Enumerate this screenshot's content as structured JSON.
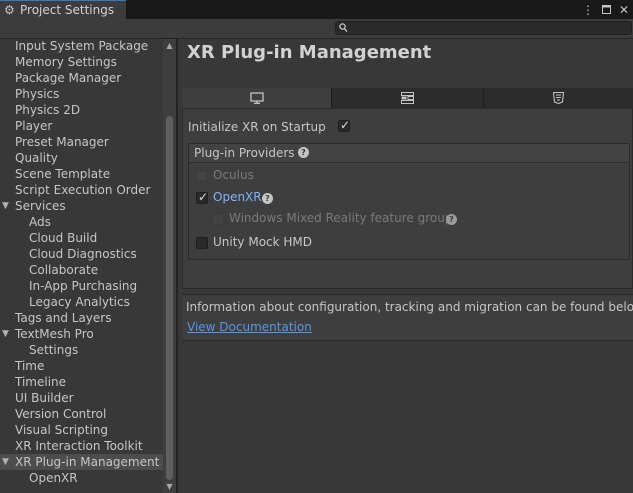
{
  "window": {
    "tab_title": "Project Settings",
    "icons": [
      "gear-icon",
      "kebab-menu-icon",
      "maximize-icon",
      "close-icon"
    ]
  },
  "search": {
    "placeholder": "",
    "icon": "search-icon"
  },
  "sidebar": {
    "items": [
      {
        "label": "Input System Package",
        "indent": 0
      },
      {
        "label": "Memory Settings",
        "indent": 0
      },
      {
        "label": "Package Manager",
        "indent": 0
      },
      {
        "label": "Physics",
        "indent": 0
      },
      {
        "label": "Physics 2D",
        "indent": 0
      },
      {
        "label": "Player",
        "indent": 0
      },
      {
        "label": "Preset Manager",
        "indent": 0
      },
      {
        "label": "Quality",
        "indent": 0
      },
      {
        "label": "Scene Template",
        "indent": 0
      },
      {
        "label": "Script Execution Order",
        "indent": 0
      },
      {
        "label": "Services",
        "indent": 0,
        "foldout": "expanded"
      },
      {
        "label": "Ads",
        "indent": 1
      },
      {
        "label": "Cloud Build",
        "indent": 1
      },
      {
        "label": "Cloud Diagnostics",
        "indent": 1
      },
      {
        "label": "Collaborate",
        "indent": 1
      },
      {
        "label": "In-App Purchasing",
        "indent": 1
      },
      {
        "label": "Legacy Analytics",
        "indent": 1
      },
      {
        "label": "Tags and Layers",
        "indent": 0
      },
      {
        "label": "TextMesh Pro",
        "indent": 0,
        "foldout": "expanded"
      },
      {
        "label": "Settings",
        "indent": 1
      },
      {
        "label": "Time",
        "indent": 0
      },
      {
        "label": "Timeline",
        "indent": 0
      },
      {
        "label": "UI Builder",
        "indent": 0
      },
      {
        "label": "Version Control",
        "indent": 0
      },
      {
        "label": "Visual Scripting",
        "indent": 0
      },
      {
        "label": "XR Interaction Toolkit",
        "indent": 0
      },
      {
        "label": "XR Plug-in Management",
        "indent": 0,
        "foldout": "expanded",
        "selected": true
      },
      {
        "label": "OpenXR",
        "indent": 1
      }
    ]
  },
  "main": {
    "title": "XR Plug-in Management",
    "platform_tabs": [
      {
        "icon": "monitor-icon",
        "active": true
      },
      {
        "icon": "grid-layout-icon",
        "active": false
      },
      {
        "icon": "html5-icon",
        "active": false
      }
    ],
    "init_on_startup": {
      "label": "Initialize XR on Startup",
      "checked": true
    },
    "providers": {
      "title": "Plug-in Providers",
      "items": [
        {
          "label": "Oculus",
          "checked": false,
          "disabled": true,
          "help": false
        },
        {
          "label": "OpenXR",
          "checked": true,
          "disabled": false,
          "help": true,
          "highlight": true
        },
        {
          "label": "Windows Mixed Reality feature group",
          "checked": false,
          "disabled": true,
          "help": true,
          "indent": 1
        },
        {
          "label": "Unity Mock HMD",
          "checked": false,
          "disabled": false,
          "help": false
        }
      ]
    },
    "info": {
      "text": "Information about configuration, tracking and migration can be found below.",
      "link": "View Documentation"
    }
  },
  "colors": {
    "accent": "#3a79bb",
    "link": "#5896ea",
    "highlight_text": "#80b4ff",
    "background": "#383838"
  }
}
